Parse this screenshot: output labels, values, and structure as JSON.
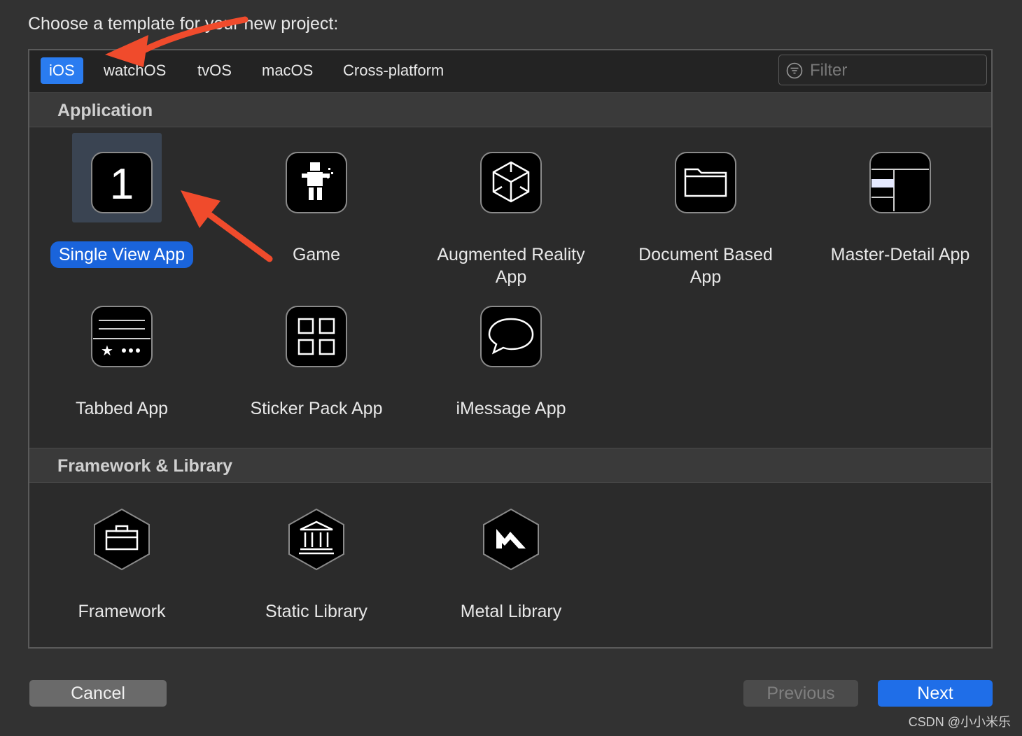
{
  "dialog": {
    "heading": "Choose a template for your new project:"
  },
  "platform_tabs": [
    {
      "label": "iOS",
      "selected": true
    },
    {
      "label": "watchOS",
      "selected": false
    },
    {
      "label": "tvOS",
      "selected": false
    },
    {
      "label": "macOS",
      "selected": false
    },
    {
      "label": "Cross-platform",
      "selected": false
    }
  ],
  "filter": {
    "placeholder": "Filter",
    "value": "",
    "icon": "filter-icon"
  },
  "sections": [
    {
      "title": "Application",
      "templates": [
        {
          "label": "Single View App",
          "icon": "single-view-app-icon",
          "selected": true
        },
        {
          "label": "Game",
          "icon": "game-icon",
          "selected": false
        },
        {
          "label": "Augmented Reality App",
          "icon": "augmented-reality-icon",
          "selected": false
        },
        {
          "label": "Document Based App",
          "icon": "document-folder-icon",
          "selected": false
        },
        {
          "label": "Master-Detail App",
          "icon": "master-detail-icon",
          "selected": false
        },
        {
          "label": "Tabbed App",
          "icon": "tabbed-app-icon",
          "selected": false
        },
        {
          "label": "Sticker Pack App",
          "icon": "sticker-grid-icon",
          "selected": false
        },
        {
          "label": "iMessage App",
          "icon": "message-bubble-icon",
          "selected": false
        }
      ]
    },
    {
      "title": "Framework & Library",
      "templates": [
        {
          "label": "Framework",
          "icon": "toolbox-icon",
          "selected": false
        },
        {
          "label": "Static Library",
          "icon": "bank-building-icon",
          "selected": false
        },
        {
          "label": "Metal Library",
          "icon": "metal-icon",
          "selected": false
        }
      ]
    }
  ],
  "buttons": {
    "cancel": "Cancel",
    "previous": "Previous",
    "next": "Next"
  },
  "watermark": "CSDN @小小米乐",
  "colors": {
    "accent": "#2a7cf0",
    "selection": "#1a64db",
    "annotation_arrow": "#f04b2c"
  }
}
